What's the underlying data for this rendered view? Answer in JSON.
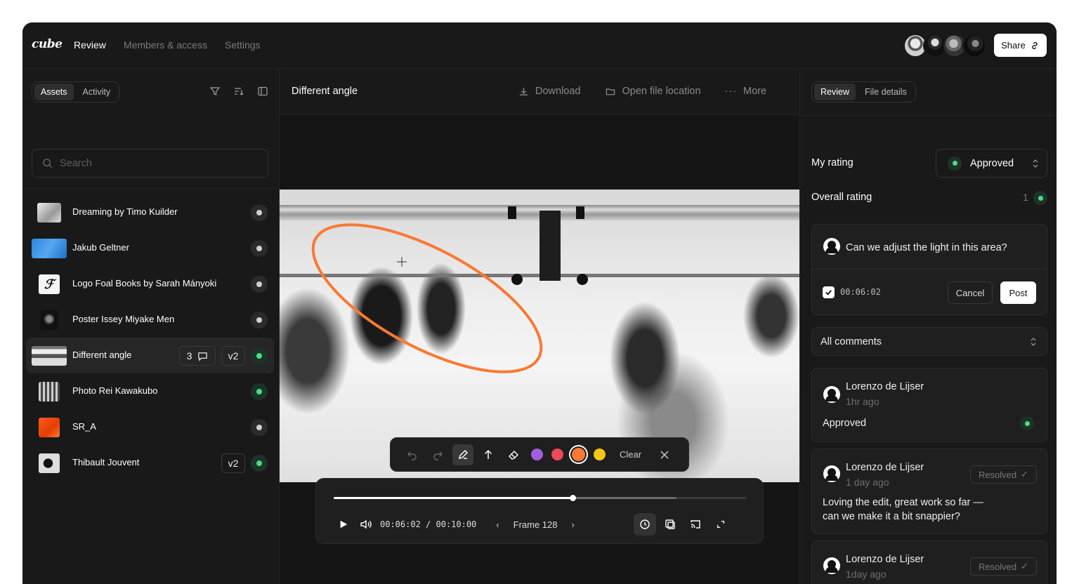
{
  "app": {
    "logo": "cube"
  },
  "nav": {
    "items": [
      "Review",
      "Members & access",
      "Settings"
    ],
    "active": "Review"
  },
  "header": {
    "share_label": "Share"
  },
  "left": {
    "tabs": [
      "Assets",
      "Activity"
    ],
    "search_placeholder": "Search",
    "assets": [
      {
        "name": "Dreaming by Timo Kuilder",
        "status": "grey"
      },
      {
        "name": "Jakub Geltner",
        "status": "grey"
      },
      {
        "name": "Logo Foal Books by Sarah Mányoki",
        "status": "grey"
      },
      {
        "name": "Poster Issey Miyake Men",
        "status": "grey"
      },
      {
        "name": "Different angle",
        "status": "green",
        "comments": "3",
        "version": "v2",
        "selected": true
      },
      {
        "name": "Photo Rei Kawakubo",
        "status": "green"
      },
      {
        "name": "SR_A",
        "status": "grey"
      },
      {
        "name": "Thibault Jouvent",
        "status": "green",
        "version": "v2"
      }
    ]
  },
  "center": {
    "title": "Different angle",
    "actions": {
      "download": "Download",
      "open": "Open file location",
      "more": "More"
    },
    "annotate": {
      "clear": "Clear",
      "colors": [
        "#a15ee0",
        "#ef4857",
        "#f97a34",
        "#f5c518"
      ],
      "active_color": "#f97a34"
    },
    "player": {
      "time": "00:06:02 / 00:10:00",
      "frame": "Frame 128",
      "progress": 0.578,
      "buffered": 0.83
    }
  },
  "right": {
    "tabs": [
      "Review",
      "File details"
    ],
    "my_rating_label": "My rating",
    "my_rating_value": "Approved",
    "overall_label": "Overall rating",
    "overall_count": "1",
    "compose": {
      "text": "Can we adjust the light in this area?",
      "timestamp": "00:06:02",
      "cancel": "Cancel",
      "post": "Post"
    },
    "filter_label": "All comments",
    "comments": [
      {
        "author": "Lorenzo de Lijser",
        "ago": "1hr ago",
        "text": "Approved"
      },
      {
        "author": "Lorenzo de Lijser",
        "ago": "1 day ago",
        "text1": "Loving the edit, great work so far —",
        "text2": "can we make it a bit snappier?",
        "status": "Resolved"
      },
      {
        "author": "Lorenzo de Lijser",
        "ago": "1day ago",
        "status": "Resolved"
      }
    ]
  }
}
